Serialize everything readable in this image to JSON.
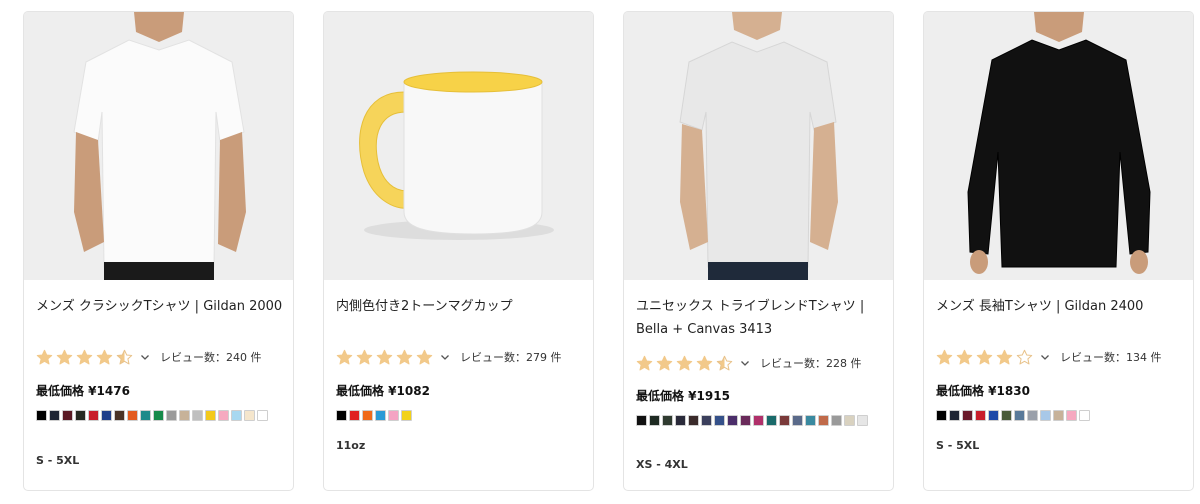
{
  "products": [
    {
      "title": "メンズ クラシックTシャツ | Gildan 2000",
      "rating": 4.5,
      "reviews_label": "レビュー数：240 件",
      "price_label": "最低価格 ¥1476",
      "colors": [
        "#000000",
        "#1f2533",
        "#5a1a24",
        "#262a22",
        "#c81d2a",
        "#1f3f8a",
        "#4a3326",
        "#e35b1f",
        "#1f8a8a",
        "#178a4a",
        "#9a9a9a",
        "#c7b299",
        "#bfbfbf",
        "#f3c91b",
        "#f6a9c0",
        "#a8d8f0",
        "#f5e6cc",
        "#ffffff"
      ],
      "size_label": "S - 5XL"
    },
    {
      "title": "内側色付き2トーンマグカップ",
      "rating": 5,
      "reviews_label": "レビュー数：279 件",
      "price_label": "最低価格 ¥1082",
      "colors": [
        "#000000",
        "#e02020",
        "#f06a1a",
        "#2a9ad6",
        "#f4a3c3",
        "#f2d21a"
      ],
      "size_label": "11oz"
    },
    {
      "title": "ユニセックス トライブレンドTシャツ | Bella + Canvas 3413",
      "rating": 4.5,
      "reviews_label": "レビュー数：228 件",
      "price_label": "最低価格 ¥1915",
      "colors": [
        "#111111",
        "#1e2a22",
        "#2f3b30",
        "#2a2a3a",
        "#3a2a2a",
        "#3b3f5c",
        "#35518a",
        "#4b2e6a",
        "#6a2a5a",
        "#b0306a",
        "#1a6a6a",
        "#7a3a3a",
        "#5a6a8a",
        "#3a8aa0",
        "#c06a4a",
        "#9a9a9a",
        "#d9d2c0",
        "#e6e6e6"
      ],
      "size_label": "XS - 4XL"
    },
    {
      "title": "メンズ 長袖Tシャツ | Gildan 2400",
      "rating": 4,
      "reviews_label": "レビュー数：134 件",
      "price_label": "最低価格 ¥1830",
      "colors": [
        "#000000",
        "#1f2533",
        "#6a1a2a",
        "#c81d2a",
        "#1f4aa8",
        "#4a5a3a",
        "#5a7a9a",
        "#9aa0aa",
        "#a8c8e8",
        "#c7b299",
        "#f6a9c0",
        "#ffffff"
      ],
      "size_label": "S - 5XL"
    }
  ],
  "icons": {
    "star": "star-icon",
    "chevron": "chevron-down-icon"
  },
  "accent": {
    "star": "#f2c98a",
    "star_empty_stroke": "#e8c28a"
  }
}
